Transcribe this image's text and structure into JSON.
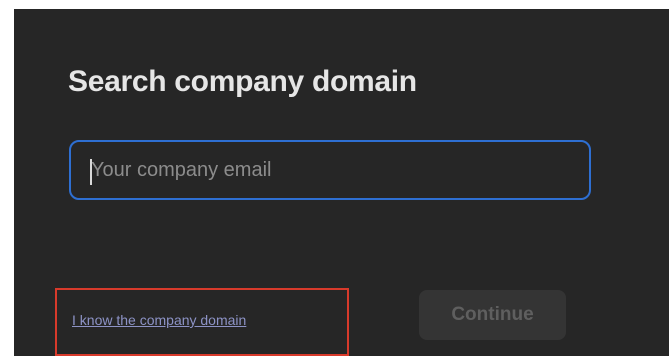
{
  "dialog": {
    "title": "Search company domain",
    "email_input": {
      "value": "",
      "placeholder": "Your company email"
    },
    "domain_link_label": "I know the company domain",
    "continue_label": "Continue",
    "continue_enabled": false
  },
  "colors": {
    "panel_background": "#262626",
    "input_border_focus": "#2e6fd2",
    "link": "#8d93c6",
    "highlight_box": "#d83a2b",
    "button_disabled_bg": "#343434",
    "button_disabled_text": "#5f5f5f"
  }
}
